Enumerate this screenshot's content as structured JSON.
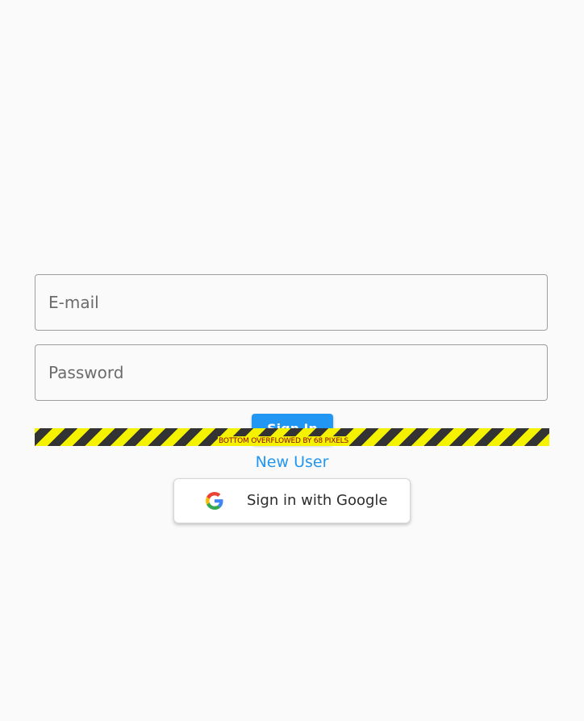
{
  "form": {
    "email_placeholder": "E-mail",
    "email_value": "",
    "password_placeholder": "Password",
    "password_value": "",
    "signin_label": "Sign In",
    "new_user_label": "New User"
  },
  "google": {
    "label": "Sign in with Google",
    "icon": "google-g-icon"
  },
  "overflow_warning": {
    "text": "BOTTOM OVERFLOWED BY 68 PIXELS"
  },
  "colors": {
    "accent": "#2196f3",
    "warning_yellow": "#f5f200",
    "warning_dark": "#333333",
    "warning_text": "#8b0000"
  }
}
